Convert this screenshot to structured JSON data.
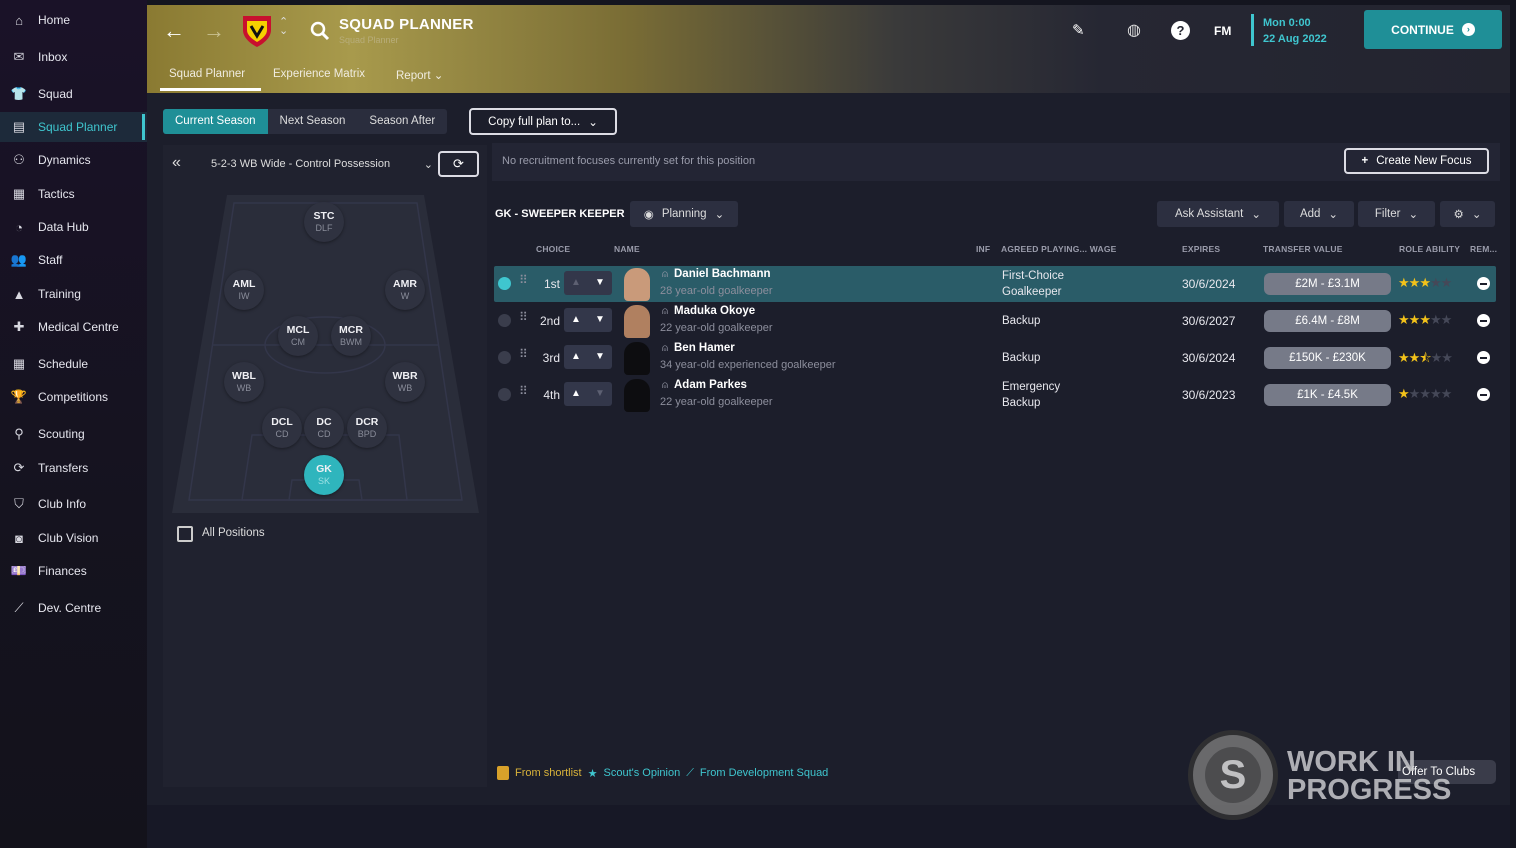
{
  "sidebar": {
    "items": [
      {
        "label": "Home",
        "icon": "home-icon",
        "glyph": "⌂"
      },
      {
        "label": "Inbox",
        "icon": "inbox-icon",
        "glyph": "✉"
      },
      {
        "label": "Squad",
        "icon": "squad-icon",
        "glyph": "👕"
      },
      {
        "label": "Squad Planner",
        "icon": "squad-planner-icon",
        "glyph": "▤",
        "active": true
      },
      {
        "label": "Dynamics",
        "icon": "dynamics-icon",
        "glyph": "⚇"
      },
      {
        "label": "Tactics",
        "icon": "tactics-icon",
        "glyph": "▦"
      },
      {
        "label": "Data Hub",
        "icon": "data-hub-icon",
        "glyph": "◔"
      },
      {
        "label": "Staff",
        "icon": "staff-icon",
        "glyph": "👥"
      },
      {
        "label": "Training",
        "icon": "training-icon",
        "glyph": "▲"
      },
      {
        "label": "Medical Centre",
        "icon": "medical-icon",
        "glyph": "✚"
      },
      {
        "label": "Schedule",
        "icon": "schedule-icon",
        "glyph": "▦"
      },
      {
        "label": "Competitions",
        "icon": "trophy-icon",
        "glyph": "🏆"
      },
      {
        "label": "Scouting",
        "icon": "scouting-icon",
        "glyph": "⚲"
      },
      {
        "label": "Transfers",
        "icon": "transfers-icon",
        "glyph": "⟳"
      },
      {
        "label": "Club Info",
        "icon": "shield-icon",
        "glyph": "⛉"
      },
      {
        "label": "Club Vision",
        "icon": "vision-icon",
        "glyph": "◙"
      },
      {
        "label": "Finances",
        "icon": "finances-icon",
        "glyph": "💷"
      },
      {
        "label": "Dev. Centre",
        "icon": "dev-centre-icon",
        "glyph": "⟋"
      }
    ]
  },
  "header": {
    "title": "SQUAD PLANNER",
    "subtitle": "Squad Planner",
    "date_day": "Mon 0:00",
    "date": "22 Aug 2022",
    "continue": "CONTINUE",
    "fm": "FM",
    "tabs": [
      "Squad Planner",
      "Experience Matrix",
      "Report"
    ]
  },
  "seasons": [
    "Current Season",
    "Next Season",
    "Season After"
  ],
  "copy_plan": "Copy full plan to...",
  "tactic": "5-2-3 WB Wide - Control Possession",
  "positions": [
    {
      "abbr": "STC",
      "role": "DLF"
    },
    {
      "abbr": "AML",
      "role": "IW"
    },
    {
      "abbr": "AMR",
      "role": "W"
    },
    {
      "abbr": "MCL",
      "role": "CM"
    },
    {
      "abbr": "MCR",
      "role": "BWM"
    },
    {
      "abbr": "WBL",
      "role": "WB"
    },
    {
      "abbr": "WBR",
      "role": "WB"
    },
    {
      "abbr": "DCL",
      "role": "CD"
    },
    {
      "abbr": "DC",
      "role": "CD"
    },
    {
      "abbr": "DCR",
      "role": "BPD"
    },
    {
      "abbr": "GK",
      "role": "SK"
    }
  ],
  "all_positions": "All Positions",
  "recruitment": {
    "message": "No recruitment focuses currently set for this position",
    "create": "Create New Focus"
  },
  "position_title": "GK - SWEEPER KEEPER",
  "planning": "Planning",
  "toolbar": {
    "ask": "Ask Assistant",
    "add": "Add",
    "filter": "Filter"
  },
  "columns": {
    "choice": "CHOICE",
    "name": "NAME",
    "inf": "INF",
    "agreed": "AGREED PLAYING... WAGE",
    "expires": "EXPIRES",
    "value": "TRANSFER VALUE",
    "ability": "ROLE ABILITY",
    "rem": "REM..."
  },
  "players": [
    {
      "choice": "1st",
      "name": "Daniel Bachmann",
      "desc": "28 year-old goalkeeper",
      "role": "First-Choice Goalkeeper",
      "expires": "30/6/2024",
      "value": "£2M - £3.1M",
      "ability": 3
    },
    {
      "choice": "2nd",
      "name": "Maduka Okoye",
      "desc": "22 year-old goalkeeper",
      "role": "Backup",
      "expires": "30/6/2027",
      "value": "£6.4M - £8M",
      "ability": 3
    },
    {
      "choice": "3rd",
      "name": "Ben Hamer",
      "desc": "34 year-old experienced goalkeeper",
      "role": "Backup",
      "expires": "30/6/2024",
      "value": "£150K - £230K",
      "ability": 2.5
    },
    {
      "choice": "4th",
      "name": "Adam Parkes",
      "desc": "22 year-old goalkeeper",
      "role": "Emergency Backup",
      "expires": "30/6/2023",
      "value": "£1K - £4.5K",
      "ability": 1
    }
  ],
  "legend": {
    "shortlist": "From shortlist",
    "scout": "Scout's Opinion",
    "dev": "From Development Squad"
  },
  "offer": "Offer To Clubs",
  "watermark": "WORK IN PROGRESS",
  "colors": {
    "accent": "#3fc6cf",
    "teal": "#1f8f97",
    "star": "#f2c21a"
  }
}
